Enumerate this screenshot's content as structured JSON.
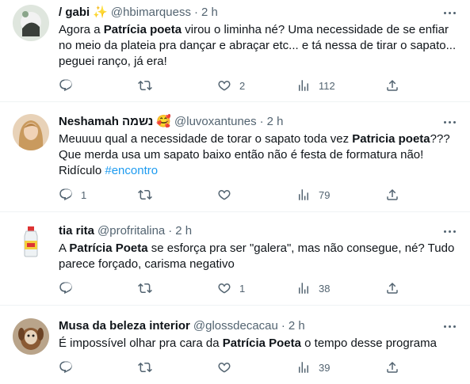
{
  "tweets": [
    {
      "name": "/ gabi",
      "emoji": "✨",
      "handle": "@hbimarquess",
      "time": "2 h",
      "text_parts": [
        "Agora a ",
        "Patrícia poeta",
        " virou o liminha né? Uma necessidade de se enfiar no meio da plateia pra dançar e abraçar etc... e tá nessa de tirar o sapato... peguei ranço, já era!"
      ],
      "reply_count": "",
      "retweet_count": "",
      "like_count": "2",
      "view_count": "112"
    },
    {
      "name": "Neshamah נשמה",
      "emoji": "🥰",
      "handle": "@luvoxantunes",
      "time": "2 h",
      "text_parts": [
        "Meuuuu qual a necessidade de torar o sapato toda vez ",
        "Patricia poeta",
        "??? Que merda usa um sapato baixo então não é festa de formatura não! Ridículo ",
        "#encontro"
      ],
      "reply_count": "1",
      "retweet_count": "",
      "like_count": "",
      "view_count": "79"
    },
    {
      "name": "tia rita",
      "emoji": "",
      "handle": "@profritalina",
      "time": "2 h",
      "text_parts": [
        "A ",
        "Patrícia Poeta",
        " se esforça pra ser \"galera\", mas não consegue, né? Tudo parece forçado, carisma negativo"
      ],
      "reply_count": "",
      "retweet_count": "",
      "like_count": "1",
      "view_count": "38"
    },
    {
      "name": "Musa da beleza interior",
      "emoji": "",
      "handle": "@glossdecacau",
      "time": "2 h",
      "text_parts": [
        "É impossível olhar pra cara da ",
        "Patrícia Poeta",
        " o tempo desse programa"
      ],
      "reply_count": "",
      "retweet_count": "",
      "like_count": "",
      "view_count": "39"
    }
  ],
  "dot_separator": "·",
  "icons": {
    "reply": "reply-icon",
    "retweet": "retweet-icon",
    "like": "heart-icon",
    "views": "views-chart-icon",
    "share": "share-icon",
    "more": "more-dots-icon"
  },
  "colors": {
    "text": "#0f1419",
    "secondary": "#536471",
    "hashtag": "#1d9bf0",
    "divider": "#eff3f4"
  }
}
